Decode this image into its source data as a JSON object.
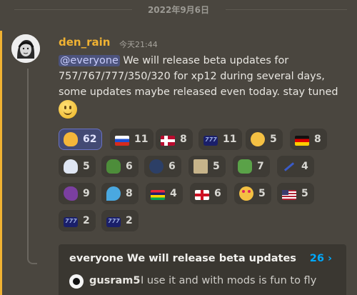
{
  "date_divider": "2022年9月6日",
  "message": {
    "author": "den_rain",
    "timestamp": "今天21:44",
    "mention": "@everyone",
    "text": " We will release beta updates for 757/767/777/350/320 for xp12 during several days, some updates maybe released even today. stay tuned ",
    "inline_emoji": "slightly-smiling-face"
  },
  "reactions": [
    {
      "emoji": "clap",
      "count": "62",
      "active": true
    },
    {
      "emoji": "flag-ru",
      "count": "11"
    },
    {
      "emoji": "flag-no",
      "count": "8"
    },
    {
      "emoji": "777-logo",
      "count": "11"
    },
    {
      "emoji": "thinking",
      "count": "5"
    },
    {
      "emoji": "flag-de",
      "count": "8"
    },
    {
      "emoji": "ghost",
      "count": "5"
    },
    {
      "emoji": "pepe",
      "count": "6"
    },
    {
      "emoji": "train",
      "count": "6"
    },
    {
      "emoji": "photo-face",
      "count": "5"
    },
    {
      "emoji": "pepe-2",
      "count": "7"
    },
    {
      "emoji": "plane",
      "count": "4"
    },
    {
      "emoji": "eggplant",
      "count": "9"
    },
    {
      "emoji": "sweat-drops",
      "count": "8"
    },
    {
      "emoji": "flag-mu",
      "count": "4"
    },
    {
      "emoji": "flag-england",
      "count": "6"
    },
    {
      "emoji": "heart-eyes",
      "count": "5"
    },
    {
      "emoji": "flag-us",
      "count": "5"
    },
    {
      "emoji": "777-logo",
      "count": "2"
    },
    {
      "emoji": "777-logo",
      "count": "2"
    }
  ],
  "thread": {
    "title": "everyone We will release beta updates",
    "count": "26 ›",
    "last_user": "gusram5",
    "last_message": "I use it and with mods is fun to fly"
  }
}
